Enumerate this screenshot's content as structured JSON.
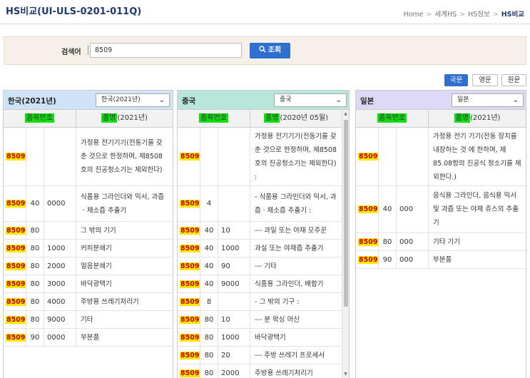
{
  "header": {
    "title": "HS비교(UI-ULS-0201-011Q)",
    "breadcrumb": [
      "Home",
      "세계HS",
      "HS정보",
      "HS비교"
    ]
  },
  "search": {
    "label": "검색어",
    "value": "8509",
    "button_label": "조회"
  },
  "lang_buttons": [
    "국문",
    "영문",
    "원문"
  ],
  "lang_active": "국문",
  "panels": {
    "korea": {
      "title": "한국(2021년)",
      "select_value": "한국(2021년)",
      "col_code": "품목번호",
      "col_name_hl": "품명",
      "col_name_rest": "(2021년)",
      "header_color": "#cfe3f7",
      "rows": [
        {
          "code": "8509",
          "sub1": "",
          "sub2": "",
          "name": "가정용 전기기기(전동기를 갖춘 것으로 한정하며, 제8508호의 진공청소기는 제외한다)"
        },
        {
          "code": "8509",
          "sub1": "40",
          "sub2": "0000",
          "name": "식품용 그라인더와 믹서, 과즙ㆍ채소즙 추출기"
        },
        {
          "code": "8509",
          "sub1": "80",
          "sub2": "",
          "name": "그 밖의 기기"
        },
        {
          "code": "8509",
          "sub1": "80",
          "sub2": "1000",
          "name": "커피분쇄기"
        },
        {
          "code": "8509",
          "sub1": "80",
          "sub2": "2000",
          "name": "얼음분쇄기"
        },
        {
          "code": "8509",
          "sub1": "80",
          "sub2": "3000",
          "name": "바닥광택기"
        },
        {
          "code": "8509",
          "sub1": "80",
          "sub2": "4000",
          "name": "주방용 쓰레기처리기"
        },
        {
          "code": "8509",
          "sub1": "80",
          "sub2": "9000",
          "name": "기타"
        },
        {
          "code": "8509",
          "sub1": "90",
          "sub2": "0000",
          "name": "부분품"
        }
      ]
    },
    "china": {
      "title": "중국",
      "select_value": "중국",
      "col_code": "품목번호",
      "col_name_hl": "품명",
      "col_name_rest": "(2020년 05월)",
      "header_color": "#b9e6db",
      "rows": [
        {
          "code": "8509",
          "sub1": "",
          "sub2": "",
          "name": "가정용 전기기기(전동기를 갖춘 것으로 한정하며, 제8508호의 진공청소기는 제외한다) :"
        },
        {
          "code": "8509",
          "sub1": "4",
          "sub2": "",
          "name": "- 식품용 그라인더와 믹서, 과즙ㆍ채소즙 추출기 :"
        },
        {
          "code": "8509",
          "sub1": "40",
          "sub2": "10",
          "name": "--- 과일 또는 야채 모주꾼"
        },
        {
          "code": "8509",
          "sub1": "40",
          "sub2": "1000",
          "name": "과실 또는 야채즙 추출기"
        },
        {
          "code": "8509",
          "sub1": "40",
          "sub2": "90",
          "name": "--- 기타"
        },
        {
          "code": "8509",
          "sub1": "40",
          "sub2": "9000",
          "name": "식품용 그라인더, 배합기"
        },
        {
          "code": "8509",
          "sub1": "8",
          "sub2": "",
          "name": "- 그 밖의 기구 :"
        },
        {
          "code": "8509",
          "sub1": "80",
          "sub2": "10",
          "name": "--- 분 왁싱 머신"
        },
        {
          "code": "8509",
          "sub1": "80",
          "sub2": "1000",
          "name": "바닥광택기"
        },
        {
          "code": "8509",
          "sub1": "80",
          "sub2": "20",
          "name": "--- 주방 쓰레기 프로세서"
        },
        {
          "code": "8509",
          "sub1": "80",
          "sub2": "2000",
          "name": "주방용 쓰레기처리기"
        }
      ]
    },
    "japan": {
      "title": "일본",
      "select_value": "일본",
      "col_code": "품목번호",
      "col_name_hl": "품명",
      "col_name_rest": "(2021년)",
      "header_color": "#ddd9f5",
      "rows": [
        {
          "code": "8509",
          "sub1": "",
          "sub2": "",
          "name": "가정용 전기 기기(전동 장치를 내장하는 것 에 한하며, 제85.08항의 진공식 청소기를 제외한다.)"
        },
        {
          "code": "8509",
          "sub1": "40",
          "sub2": "000",
          "name": "음식용 그라인더, 음식용 믹서 및 과즙 또는 야채 쥬스의 추출기"
        },
        {
          "code": "8509",
          "sub1": "80",
          "sub2": "000",
          "name": "기타 기기"
        },
        {
          "code": "8509",
          "sub1": "90",
          "sub2": "000",
          "name": "부분품"
        }
      ]
    }
  }
}
